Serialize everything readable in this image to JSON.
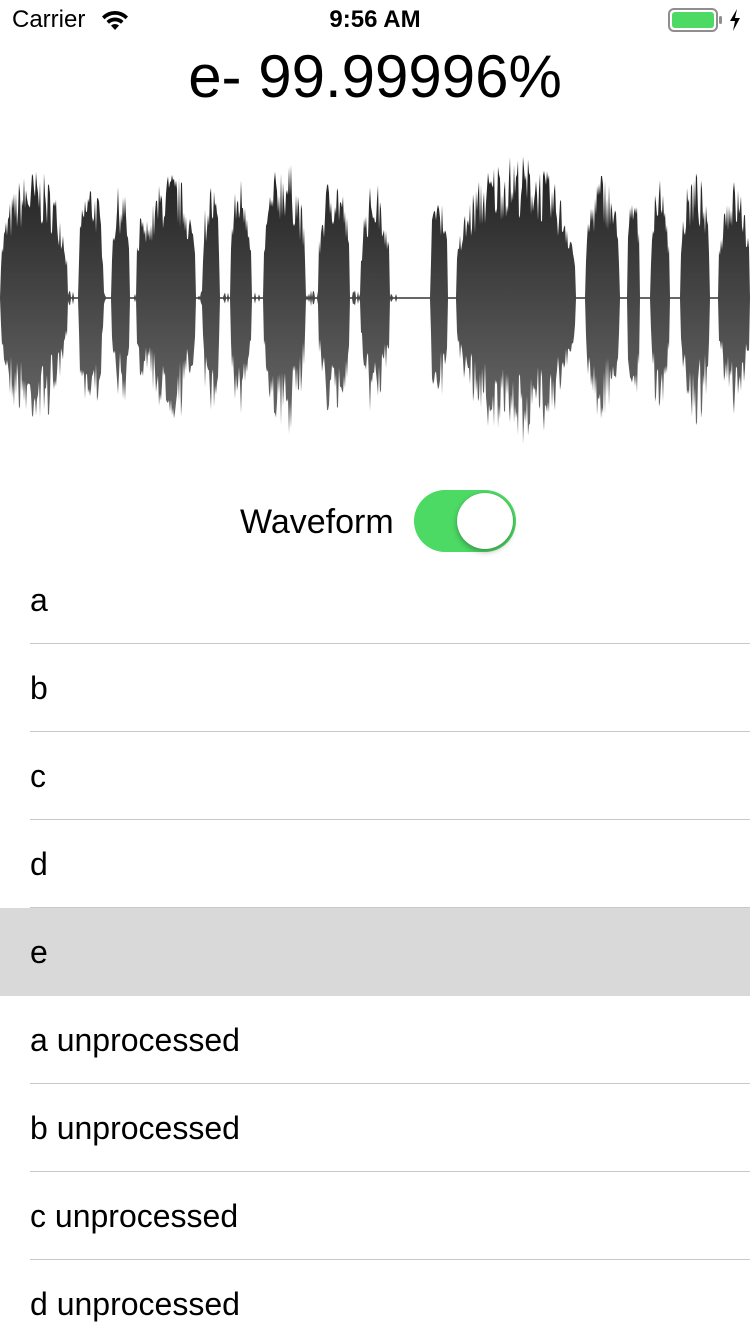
{
  "status_bar": {
    "carrier": "Carrier",
    "time": "9:56 AM",
    "wifi_icon": "wifi-icon",
    "battery_icon": "battery-icon",
    "charging_icon": "charging-bolt-icon",
    "battery_color": "#4cd964"
  },
  "prediction": {
    "title": "e- 99.99996%"
  },
  "waveform": {
    "color_top": "#1f1f1f",
    "color_bottom": "#6e6e6e"
  },
  "toggle": {
    "label": "Waveform",
    "state": "on",
    "on_color": "#4cd964"
  },
  "list": {
    "selected_index": 4,
    "selected_color": "#d9d9d9",
    "items": [
      {
        "label": "a"
      },
      {
        "label": "b"
      },
      {
        "label": "c"
      },
      {
        "label": "d"
      },
      {
        "label": "e"
      },
      {
        "label": "a unprocessed"
      },
      {
        "label": "b unprocessed"
      },
      {
        "label": "c unprocessed"
      },
      {
        "label": "d unprocessed"
      }
    ]
  }
}
